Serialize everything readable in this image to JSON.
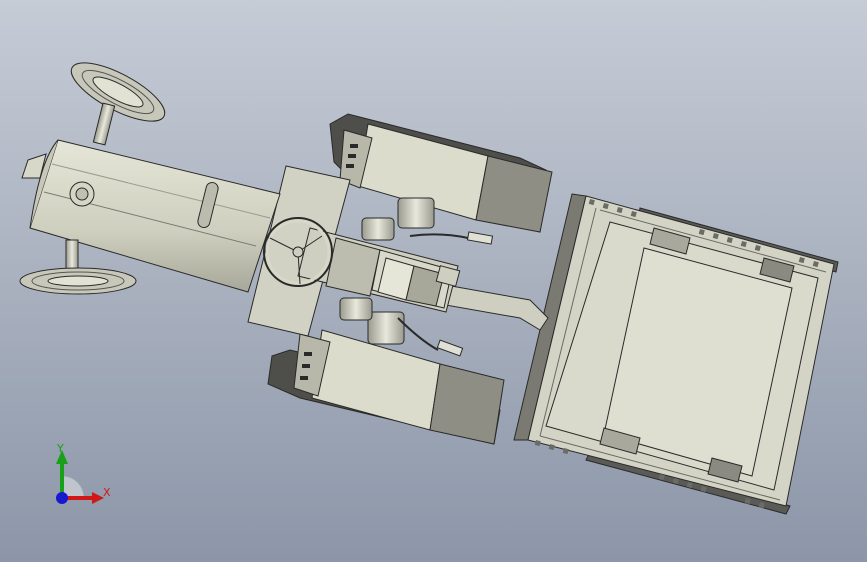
{
  "viewport": {
    "background_top": "#c4cad4",
    "background_bottom": "#8e98aa",
    "edge_color": "#2a2a2a",
    "part_color": "#d9d9c9",
    "shade_color": "#b4b4a6",
    "dark_shade": "#8c8c82"
  },
  "triad": {
    "x_label": "X",
    "y_label": "Y",
    "x_color": "#d01818",
    "y_color": "#18a018",
    "z_color": "#1818d0"
  }
}
